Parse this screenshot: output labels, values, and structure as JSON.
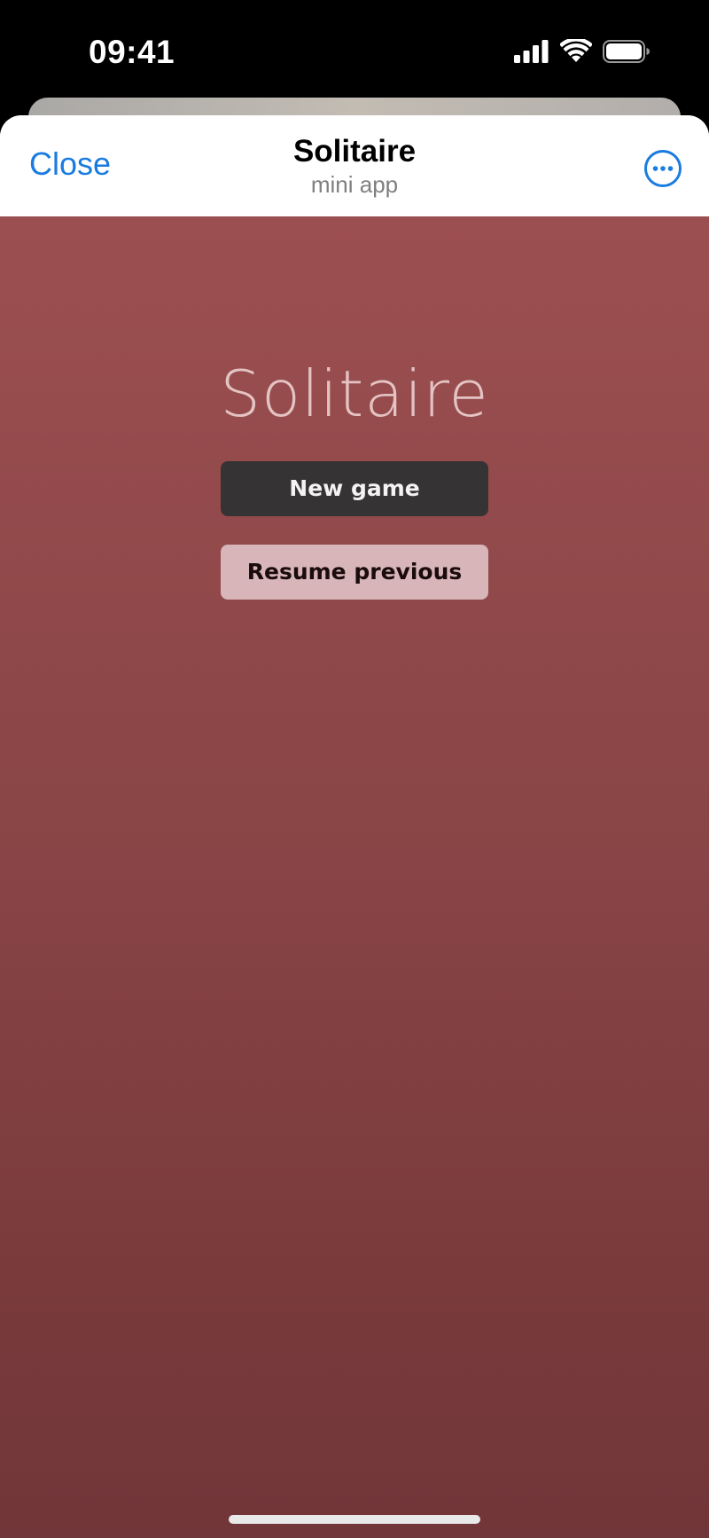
{
  "status_bar": {
    "time": "09:41",
    "icons": [
      "cellular-signal-icon",
      "wifi-icon",
      "battery-icon"
    ]
  },
  "header": {
    "close_label": "Close",
    "title": "Solitaire",
    "subtitle": "mini app",
    "more_icon": "ellipsis-circle-icon"
  },
  "game": {
    "title": "Solitaire",
    "new_game_label": "New game",
    "resume_label": "Resume previous"
  },
  "colors": {
    "accent": "#1a7ce0",
    "background_top": "#9c4f50",
    "background_bottom": "#713639",
    "new_game_button": "#353334",
    "resume_button": "#d8b5b8"
  }
}
